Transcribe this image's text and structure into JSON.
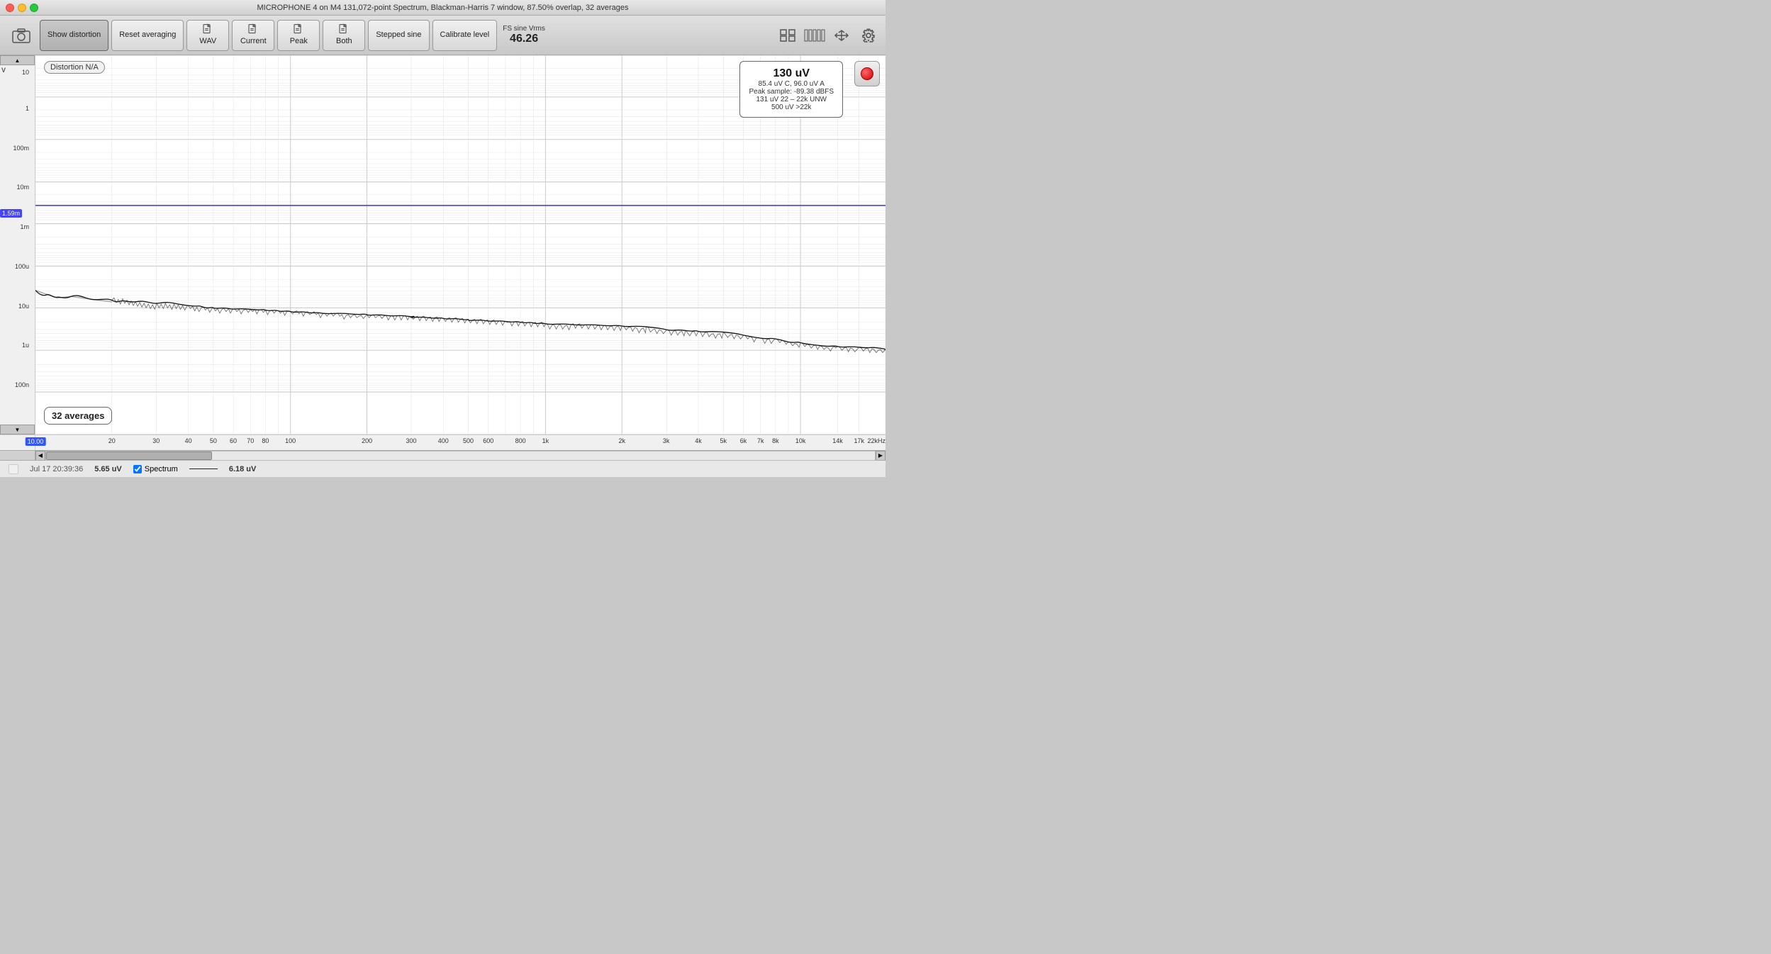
{
  "window": {
    "title": "MICROPHONE 4 on M4 131,072-point Spectrum, Blackman-Harris 7 window, 87.50% overlap, 32 averages"
  },
  "toolbar": {
    "show_distortion_label": "Show distortion",
    "reset_averaging_label": "Reset averaging",
    "wav_label": "WAV",
    "current_label": "Current",
    "peak_label": "Peak",
    "both_label": "Both",
    "stepped_sine_label": "Stepped sine",
    "calibrate_level_label": "Calibrate level",
    "fs_sine_label": "FS sine Vrms",
    "fs_sine_value": "46.26"
  },
  "chart": {
    "distortion_label": "Distortion N/A",
    "info_box": {
      "main_value": "130 uV",
      "line1": "85.4 uV C, 96.0 uV A",
      "line2": "Peak sample: -89.38 dBFS",
      "line3": "131 uV 22 – 22k UNW",
      "line4": "500 uV >22k"
    },
    "marker_value": "1.59m",
    "averages_label": "32 averages",
    "y_labels": [
      "10",
      "1",
      "100m",
      "10m",
      "1m",
      "100u",
      "10u",
      "1u",
      "100n"
    ],
    "y_axis_unit": "V",
    "x_labels": [
      "10.00",
      "20",
      "30",
      "40",
      "50",
      "60",
      "70",
      "80",
      "100",
      "200",
      "300",
      "400",
      "500",
      "600",
      "800",
      "1k",
      "2k",
      "3k",
      "4k",
      "5k",
      "6k",
      "7k",
      "8k",
      "10k",
      "14k",
      "17k",
      "22kHz"
    ]
  },
  "status_bar": {
    "timestamp": "Jul 17 20:39:36",
    "value1": "5.65 uV",
    "spectrum_label": "Spectrum",
    "value2": "6.18 uV"
  }
}
